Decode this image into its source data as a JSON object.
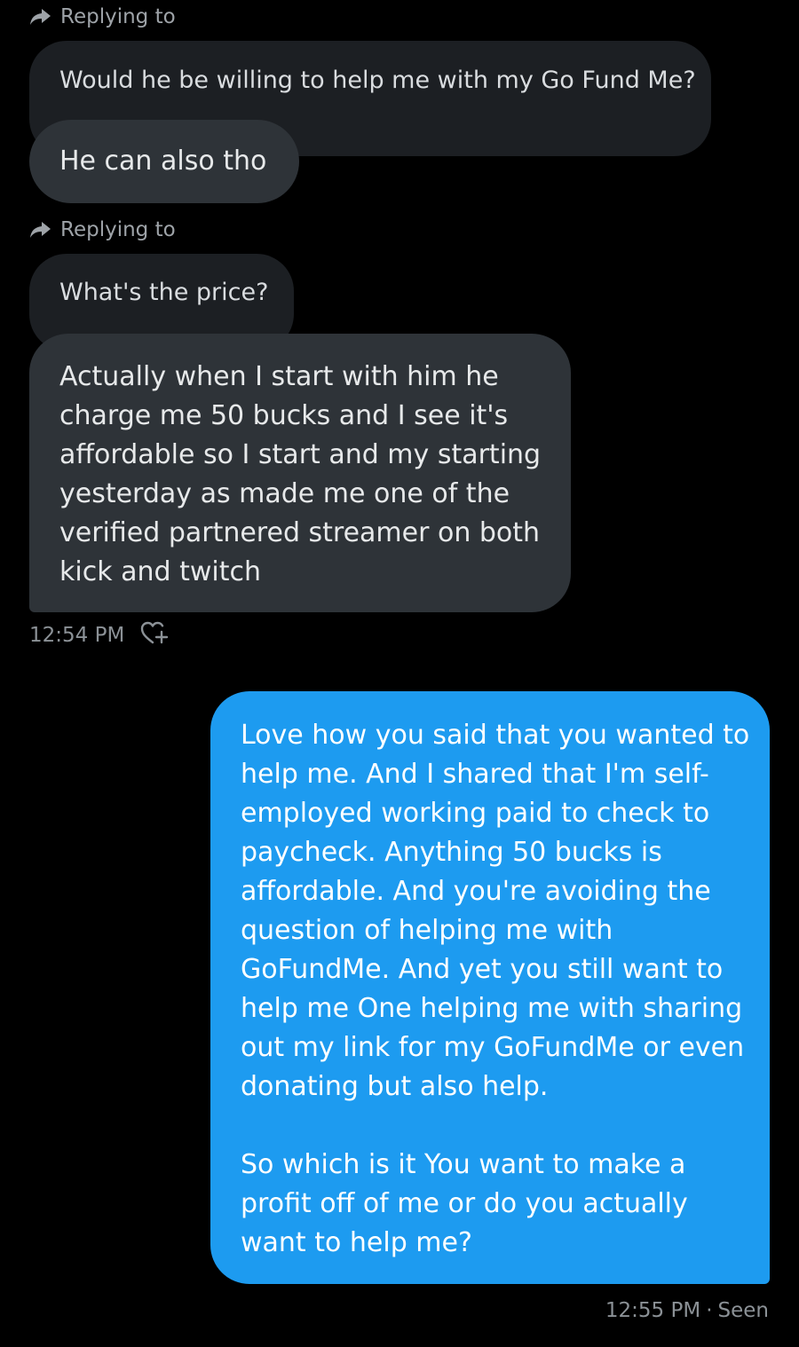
{
  "conversation": {
    "thread_1": {
      "replying_label": "Replying to",
      "quoted_text": "Would he be willing to help me with my Go Fund Me?",
      "reply_text": "He can also tho"
    },
    "thread_2": {
      "replying_label": "Replying to",
      "quoted_text": "What's the price?",
      "reply_text": "Actually when I start with him he charge me 50 bucks and I see it's affordable so I start and my starting yesterday as made me one of the verified partnered streamer on both kick and twitch",
      "timestamp": "12:54 PM",
      "react_icon": "heart-plus-icon"
    },
    "outgoing": {
      "paragraph_1": "Love how you said that you wanted to help me. And I shared that I'm self-employed working paid to check to paycheck. Anything 50 bucks is affordable. And you're avoiding the question of helping me with GoFundMe. And yet you still want to help me One helping me with sharing out my link for my GoFundMe or even donating but also help.",
      "paragraph_2": "So which is it You want to make a profit off of me or do you actually want to help me?",
      "timestamp": "12:55 PM",
      "separator": "·",
      "status": "Seen"
    }
  },
  "colors": {
    "background": "#000000",
    "incoming_bubble": "#2e3338",
    "quoted_bubble": "#1c1f23",
    "outgoing_bubble": "#1d9bf0",
    "meta_text": "#8b9196"
  }
}
